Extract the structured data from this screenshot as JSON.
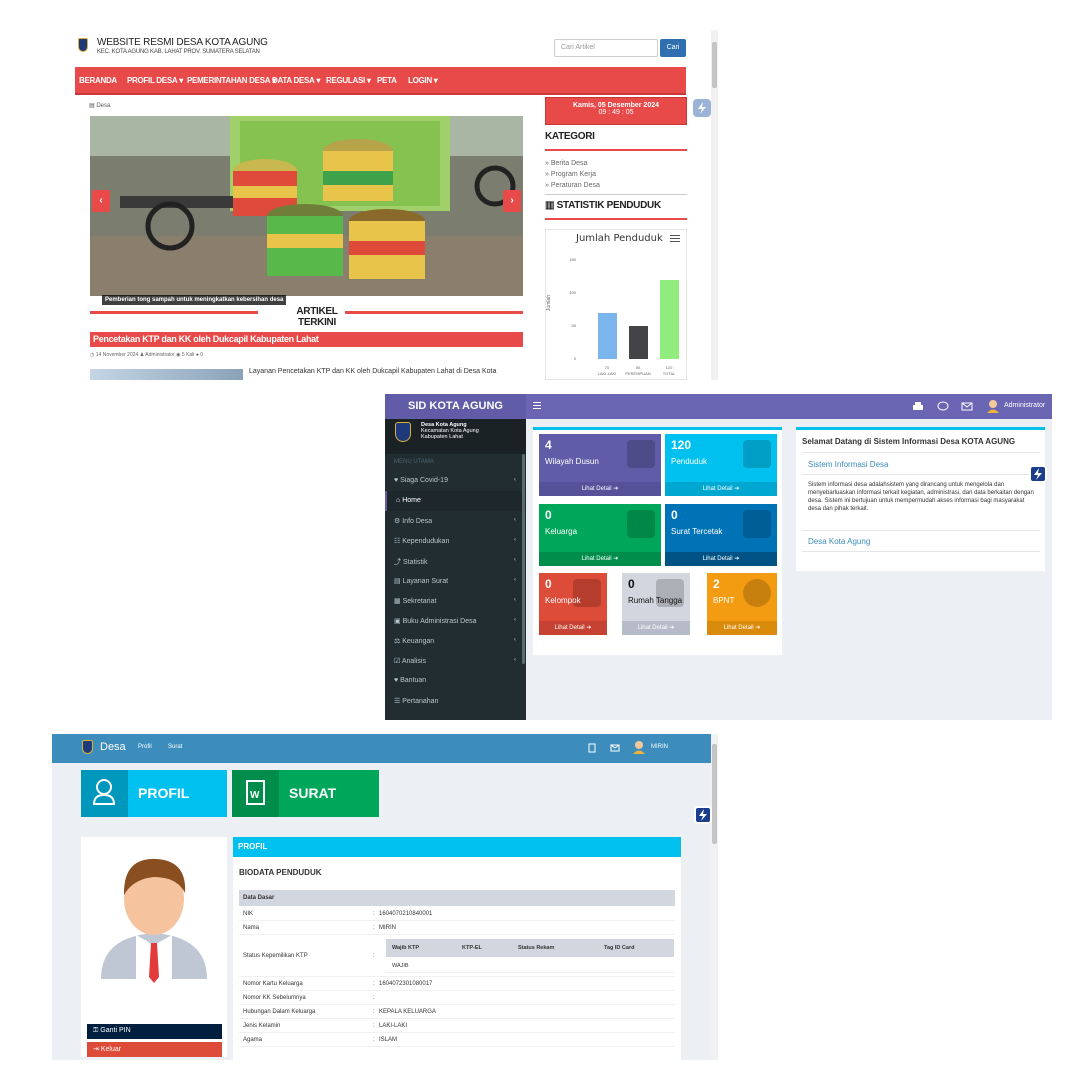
{
  "site": {
    "title": "WEBSITE RESMI DESA KOTA AGUNG",
    "subtitle": "KEC. KOTA AGUNG KAB. LAHAT PROV. SUMATERA SELATAN",
    "search_placeholder": "Cari Artikel",
    "search_button": "Cari",
    "nav": [
      "BERANDA",
      "PROFIL DESA",
      "PEMERINTAHAN DESA",
      "DATA DESA",
      "REGULASI",
      "PETA",
      "LOGIN"
    ],
    "breadcrumb": "Desa",
    "slide_caption": "Pemberian tong sampah untuk meningkatkan kebersihan desa",
    "articles_heading": "ARTIKEL TERKINI",
    "post_title": "Pencetakan KTP dan KK oleh Dukcapil Kabupaten Lahat",
    "post_date": "14 November 2024",
    "post_author": "Administrator",
    "post_views": "5 Kali",
    "post_comments": "0",
    "post_excerpt": "Layanan Pencetakan KTP dan KK oleh Dukcapil Kabupaten Lahat di Desa Kota",
    "date_line1": "Kamis, 05 Desember 2024",
    "date_line2": "09 : 49 : 05",
    "kategori_heading": "KATEGORI",
    "categories": [
      "Berita Desa",
      "Program Kerja",
      "Peraturan Desa"
    ],
    "stat_heading": "STATISTIK PENDUDUK",
    "colors": {
      "accent": "#e84a4a",
      "nav_text": "#ffffff"
    }
  },
  "chart_data": {
    "type": "bar",
    "title": "Jumlah Penduduk",
    "ylabel": "Jumlah",
    "xlabel": "",
    "ylim": [
      0,
      150
    ],
    "yticks": [
      "150",
      "100",
      "50",
      "0"
    ],
    "categories": [
      "LAKI-LAKI",
      "PEREMPUAN",
      "TOTAL"
    ],
    "values": [
      70,
      50,
      120
    ],
    "value_labels": [
      "70",
      "50",
      "120"
    ],
    "colors": [
      "#7cb5ec",
      "#434348",
      "#90ed7d"
    ]
  },
  "admin": {
    "app_name": "SID KOTA AGUNG",
    "user": "Administrator",
    "brand_lines": [
      "Desa Kota Agung",
      "Kecamatan Kota Agung",
      "Kabupaten Lahat"
    ],
    "menu_header": "MENU UTAMA",
    "menu": [
      {
        "label": "Siaga Covid-19",
        "chev": "‹"
      },
      {
        "label": "Home",
        "chev": ""
      },
      {
        "label": "Info Desa",
        "chev": "‹"
      },
      {
        "label": "Kependudukan",
        "chev": "‹"
      },
      {
        "label": "Statistik",
        "chev": "‹"
      },
      {
        "label": "Layanan Surat",
        "chev": "‹"
      },
      {
        "label": "Sekretariat",
        "chev": "‹"
      },
      {
        "label": "Buku Administrasi Desa",
        "chev": "‹"
      },
      {
        "label": "Keuangan",
        "chev": "‹"
      },
      {
        "label": "Analisis",
        "chev": "‹"
      },
      {
        "label": "Bantuan",
        "chev": ""
      },
      {
        "label": "Pertanahan",
        "chev": ""
      }
    ],
    "tiles": [
      {
        "value": "4",
        "label": "Wilayah Dusun",
        "footer": "Lihat Detail",
        "color": "#605ca8"
      },
      {
        "value": "120",
        "label": "Penduduk",
        "footer": "Lihat Detail",
        "color": "#00c0ef"
      },
      {
        "value": "0",
        "label": "Keluarga",
        "footer": "Lihat Detail",
        "color": "#00a65a"
      },
      {
        "value": "0",
        "label": "Surat Tercetak",
        "footer": "Lihat Detail",
        "color": "#0073b7"
      },
      {
        "value": "0",
        "label": "Kelompok",
        "footer": "Lihat Detail",
        "color": "#dd4b39"
      },
      {
        "value": "0",
        "label": "Rumah Tangga",
        "footer": "Lihat Detail",
        "color": "#d2d6de"
      },
      {
        "value": "2",
        "label": "BPNT",
        "footer": "Lihat Detail",
        "color": "#f39c12"
      }
    ],
    "welcome_title": "Selamat Datang di Sistem Informasi Desa KOTA AGUNG",
    "info_link": "Sistem Informasi Desa",
    "info_text": "Sistem informasi desa adalahsistem yang dirancang untuk mengelola dan menyebarluaskan informasi terkait kegiatan, administrasi, dan data berkaitan dengan desa. Sistem ini bertujuan untuk mempermudah akses informasi bagi masyarakat desa dan pihak terkait.",
    "desa_link": "Desa Kota Agung"
  },
  "citizen": {
    "brand": "Desa",
    "nav": [
      "Profil",
      "Surat"
    ],
    "user": "MIRIN",
    "btn_profil": "PROFIL",
    "btn_surat": "SURAT",
    "ganti_pin": "Ganti PIN",
    "keluar": "Keluar",
    "panel_title": "PROFIL",
    "bio_title": "BIODATA PENDUDUK",
    "section": "Data Dasar",
    "rows": [
      {
        "k": "NIK",
        "v": "1604070210840001"
      },
      {
        "k": "Nama",
        "v": "MIRIN"
      },
      {
        "k": "Status Kepemilikan KTP",
        "v": ""
      },
      {
        "k": "Nomor Kartu Keluarga",
        "v": "1604072301080017"
      },
      {
        "k": "Nomor KK Sebelumnya",
        "v": ""
      },
      {
        "k": "Hubungan Dalam Keluarga",
        "v": "KEPALA KELUARGA"
      },
      {
        "k": "Jenis Kelamin",
        "v": "LAKI-LAKI"
      },
      {
        "k": "Agama",
        "v": "ISLAM"
      }
    ],
    "ktp_headers": [
      "Wajib KTP",
      "KTP-EL",
      "Status Rekam",
      "Tag ID Card"
    ],
    "ktp_values": [
      "WAJIB",
      "",
      "",
      ""
    ],
    "colon": ":"
  }
}
